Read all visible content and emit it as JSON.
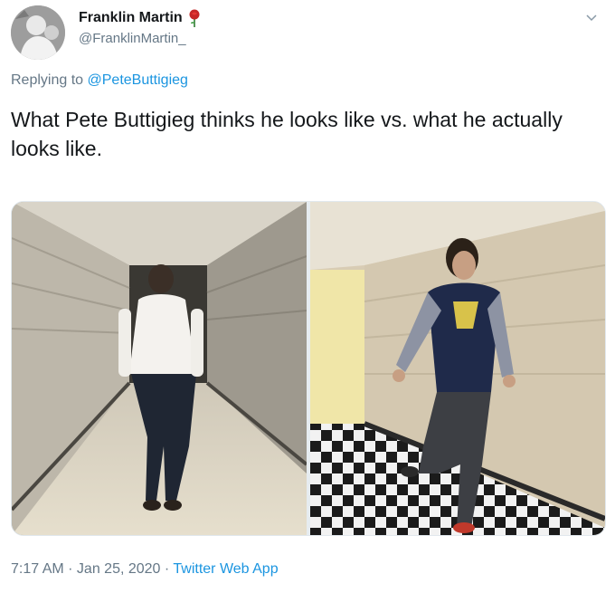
{
  "author": {
    "display_name": "Franklin Martin",
    "handle": "@FranklinMartin_",
    "emoji_icon": "rose-icon",
    "accent_color": "#1b95e0"
  },
  "reply": {
    "prefix": "Replying to",
    "mention": "@PeteButtigieg"
  },
  "tweet": {
    "text": "What Pete Buttigieg thinks he looks like vs. what he actually looks like."
  },
  "media": {
    "panels": [
      "left-photo-hallway-man-walking",
      "right-photo-hallway-man-running"
    ]
  },
  "meta": {
    "time": "7:17 AM",
    "sep1": " · ",
    "date": "Jan 25, 2020",
    "sep2": " · ",
    "source": "Twitter Web App"
  }
}
